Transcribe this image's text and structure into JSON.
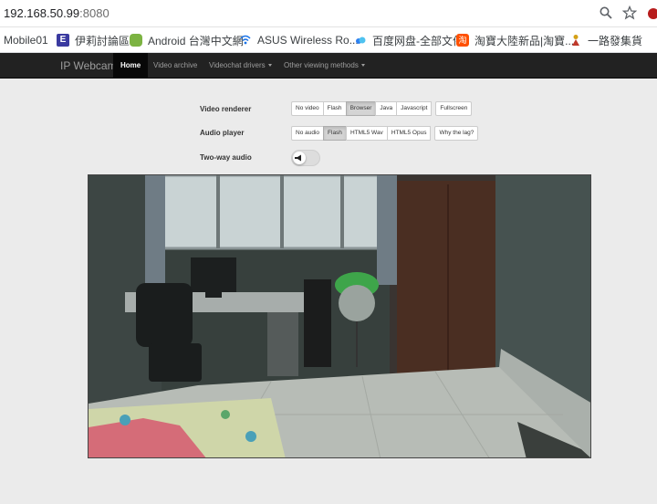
{
  "browser": {
    "url_host": "192.168.50.99",
    "url_port": ":8080"
  },
  "bookmarks": [
    {
      "label": "Mobile01",
      "color": "#1f5fbf"
    },
    {
      "label": "伊莉討論區",
      "color": "#3a3aa0"
    },
    {
      "label": "Android 台灣中文網",
      "color": "#7cb342"
    },
    {
      "label": "ASUS Wireless Ro...",
      "color": "#1a73e8"
    },
    {
      "label": "百度网盘-全部文件",
      "color": "#2f7ff0"
    },
    {
      "label": "淘寶大陸新品|淘寶...",
      "color": "#ff5000"
    },
    {
      "label": "一路發集貨",
      "color": "#d4a017"
    }
  ],
  "navbar": {
    "brand": "IP Webcam",
    "items": [
      {
        "label": "Home"
      },
      {
        "label": "Video archive"
      },
      {
        "label": "Videochat drivers"
      },
      {
        "label": "Other viewing methods"
      }
    ]
  },
  "controls": {
    "video_renderer": {
      "label": "Video renderer",
      "options": [
        "No video",
        "Flash",
        "Browser",
        "Java",
        "Javascript",
        "Fullscreen"
      ],
      "selected": "Browser"
    },
    "audio_player": {
      "label": "Audio player",
      "options": [
        "No audio",
        "Flash",
        "HTML5 Wav",
        "HTML5 Opus"
      ],
      "selected": "Flash",
      "help": "Why the lag?"
    },
    "two_way_audio": {
      "label": "Two-way audio",
      "enabled": false
    }
  }
}
